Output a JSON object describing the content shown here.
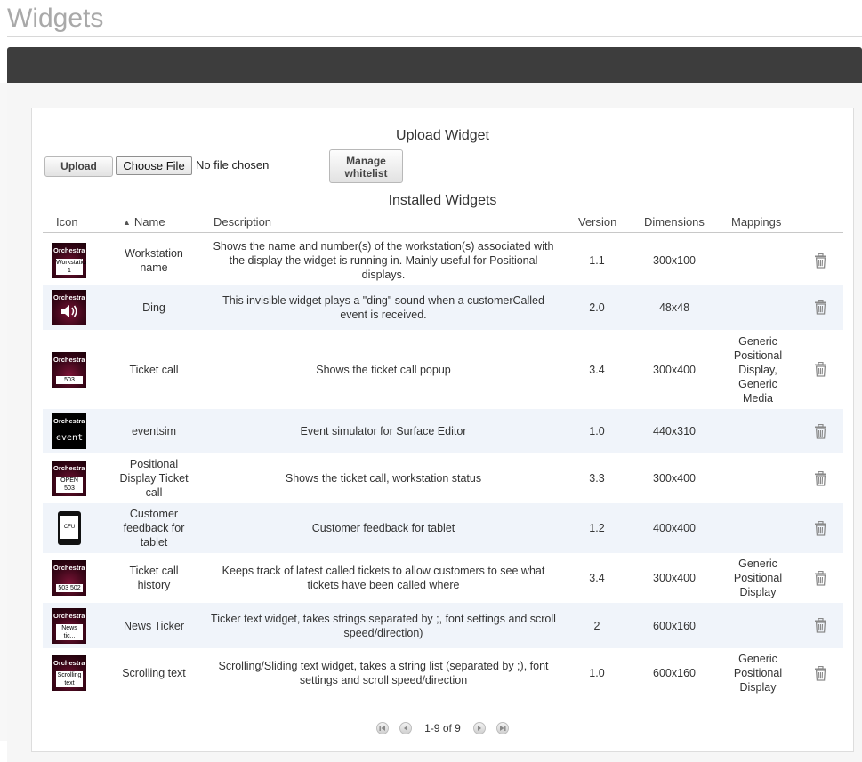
{
  "page": {
    "title": "Widgets"
  },
  "upload": {
    "heading": "Upload Widget",
    "upload_label": "Upload",
    "choose_label": "Choose File",
    "no_file_text": "No file chosen",
    "manage_line1": "Manage",
    "manage_line2": "whitelist"
  },
  "table": {
    "heading": "Installed Widgets",
    "columns": {
      "icon": "Icon",
      "name": "Name",
      "description": "Description",
      "version": "Version",
      "dimensions": "Dimensions",
      "mappings": "Mappings"
    },
    "sort_indicator": "▲",
    "rows": [
      {
        "icon": "orchestra-workstation-icon",
        "icon_label": "Workstation 1",
        "name": "Workstation name",
        "description": "Shows the name and number(s) of the workstation(s) associated with the display the widget is running in. Mainly useful for Positional displays.",
        "version": "1.1",
        "dimensions": "300x100",
        "mappings": ""
      },
      {
        "icon": "orchestra-speaker-icon",
        "icon_label": "",
        "name": "Ding",
        "description": "This invisible widget plays a \"ding\" sound when a customerCalled event is received.",
        "version": "2.0",
        "dimensions": "48x48",
        "mappings": ""
      },
      {
        "icon": "orchestra-ticket-icon",
        "icon_label": "503",
        "name": "Ticket call",
        "description": "Shows the ticket call popup",
        "version": "3.4",
        "dimensions": "300x400",
        "mappings": "Generic Positional Display, Generic Media"
      },
      {
        "icon": "orchestra-event-icon",
        "icon_label": "event",
        "name": "eventsim",
        "description": "Event simulator for Surface Editor",
        "version": "1.0",
        "dimensions": "440x310",
        "mappings": ""
      },
      {
        "icon": "orchestra-positional-icon",
        "icon_label": "OPEN 503",
        "name": "Positional Display Ticket call",
        "description": "Shows the ticket call, workstation status",
        "version": "3.3",
        "dimensions": "300x400",
        "mappings": ""
      },
      {
        "icon": "tablet-cfu-icon",
        "icon_label": "CFU",
        "name": "Customer feedback for tablet",
        "description": "Customer feedback for tablet",
        "version": "1.2",
        "dimensions": "400x400",
        "mappings": ""
      },
      {
        "icon": "orchestra-history-icon",
        "icon_label": "503 502",
        "name": "Ticket call history",
        "description": "Keeps track of latest called tickets to allow customers to see what tickets have been called where",
        "version": "3.4",
        "dimensions": "300x400",
        "mappings": "Generic Positional Display"
      },
      {
        "icon": "orchestra-news-icon",
        "icon_label": "News tic...",
        "name": "News Ticker",
        "description": "Ticker text widget, takes strings separated by ;, font settings and scroll speed/direction)",
        "version": "2",
        "dimensions": "600x160",
        "mappings": ""
      },
      {
        "icon": "orchestra-scrolling-icon",
        "icon_label": "Scrolling text",
        "name": "Scrolling text",
        "description": "Scrolling/Sliding text widget, takes a string list (separated by ;), font settings and scroll speed/direction",
        "version": "1.0",
        "dimensions": "600x160",
        "mappings": "Generic Positional Display"
      }
    ],
    "brand_text": "Orchestra"
  },
  "pager": {
    "text": "1-9 of 9"
  }
}
